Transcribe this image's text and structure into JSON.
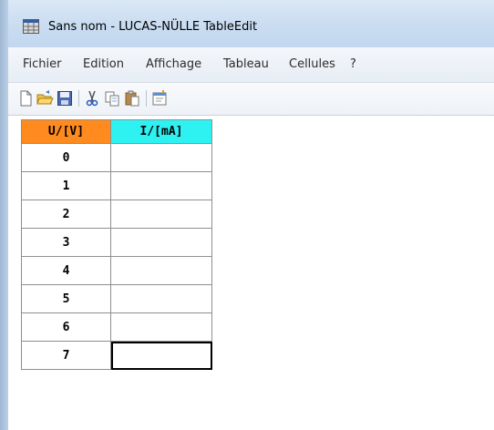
{
  "window": {
    "title": "Sans nom - LUCAS-NÜLLE TableEdit",
    "title_icon": "table-grid-icon"
  },
  "menu": {
    "items": [
      "Fichier",
      "Edition",
      "Affichage",
      "Tableau",
      "Cellules",
      "?"
    ]
  },
  "toolbar": {
    "buttons": [
      "new-document-icon",
      "open-folder-icon",
      "save-disk-icon",
      "cut-scissors-icon",
      "copy-icon",
      "paste-icon",
      "properties-icon"
    ]
  },
  "table": {
    "headers": [
      {
        "label": "U/[V]",
        "color": "#ff8a1e"
      },
      {
        "label": "I/[mA]",
        "color": "#2ef1f2"
      }
    ],
    "rows": [
      {
        "u": "0",
        "i": ""
      },
      {
        "u": "1",
        "i": ""
      },
      {
        "u": "2",
        "i": ""
      },
      {
        "u": "3",
        "i": ""
      },
      {
        "u": "4",
        "i": ""
      },
      {
        "u": "5",
        "i": ""
      },
      {
        "u": "6",
        "i": ""
      },
      {
        "u": "7",
        "i": ""
      }
    ],
    "active_cell": {
      "row": 7,
      "column": "i"
    }
  }
}
